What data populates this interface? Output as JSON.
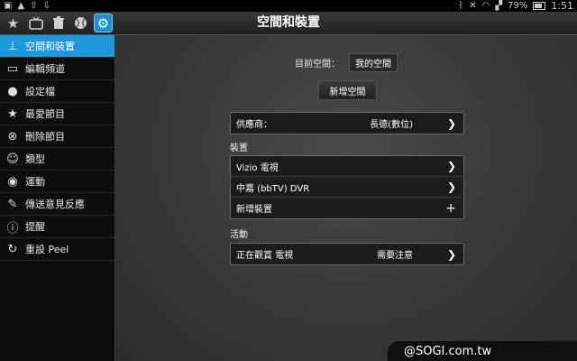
{
  "statusbar": {
    "left_icons": [
      "image-icon",
      "warning-icon",
      "upload-icon",
      "download-icon"
    ],
    "battery": "79%",
    "time": "1:51"
  },
  "toolbar": {
    "title": "空間和裝置",
    "icons": [
      "star-icon",
      "tv-icon",
      "trash-icon",
      "ball-icon",
      "gear-icon"
    ]
  },
  "sidebar": {
    "items": [
      {
        "label": "空間和裝置",
        "icon": "network-icon"
      },
      {
        "label": "編輯頻道",
        "icon": "edit-channel-icon"
      },
      {
        "label": "設定檔",
        "icon": "profile-icon"
      },
      {
        "label": "最愛節目",
        "icon": "star-icon"
      },
      {
        "label": "刪除節目",
        "icon": "delete-icon"
      },
      {
        "label": "類型",
        "icon": "masks-icon"
      },
      {
        "label": "運動",
        "icon": "ball-icon"
      },
      {
        "label": "傳送意見反應",
        "icon": "feedback-icon"
      },
      {
        "label": "提醒",
        "icon": "alert-icon"
      },
      {
        "label": "重設 Peel",
        "icon": "reset-icon"
      }
    ]
  },
  "main": {
    "current_space_label": "目前空間：",
    "current_space_value": "我的空間",
    "add_space_button": "新增空間",
    "provider": {
      "label": "供應商：",
      "value": "長德(數位)"
    },
    "devices_section": "裝置",
    "devices": [
      {
        "label": "Vizio 電視"
      },
      {
        "label": "中嘉 (bbTV) DVR"
      },
      {
        "label": "新增裝置"
      }
    ],
    "activities_section": "活動",
    "activity": {
      "label": "正在觀賞 電視",
      "status": "需要注意"
    }
  },
  "watermark": "@SOGI.com.tw",
  "colors": {
    "accent": "#1e98dc",
    "background": "#383838",
    "sidebar": "#0e0e0e"
  }
}
